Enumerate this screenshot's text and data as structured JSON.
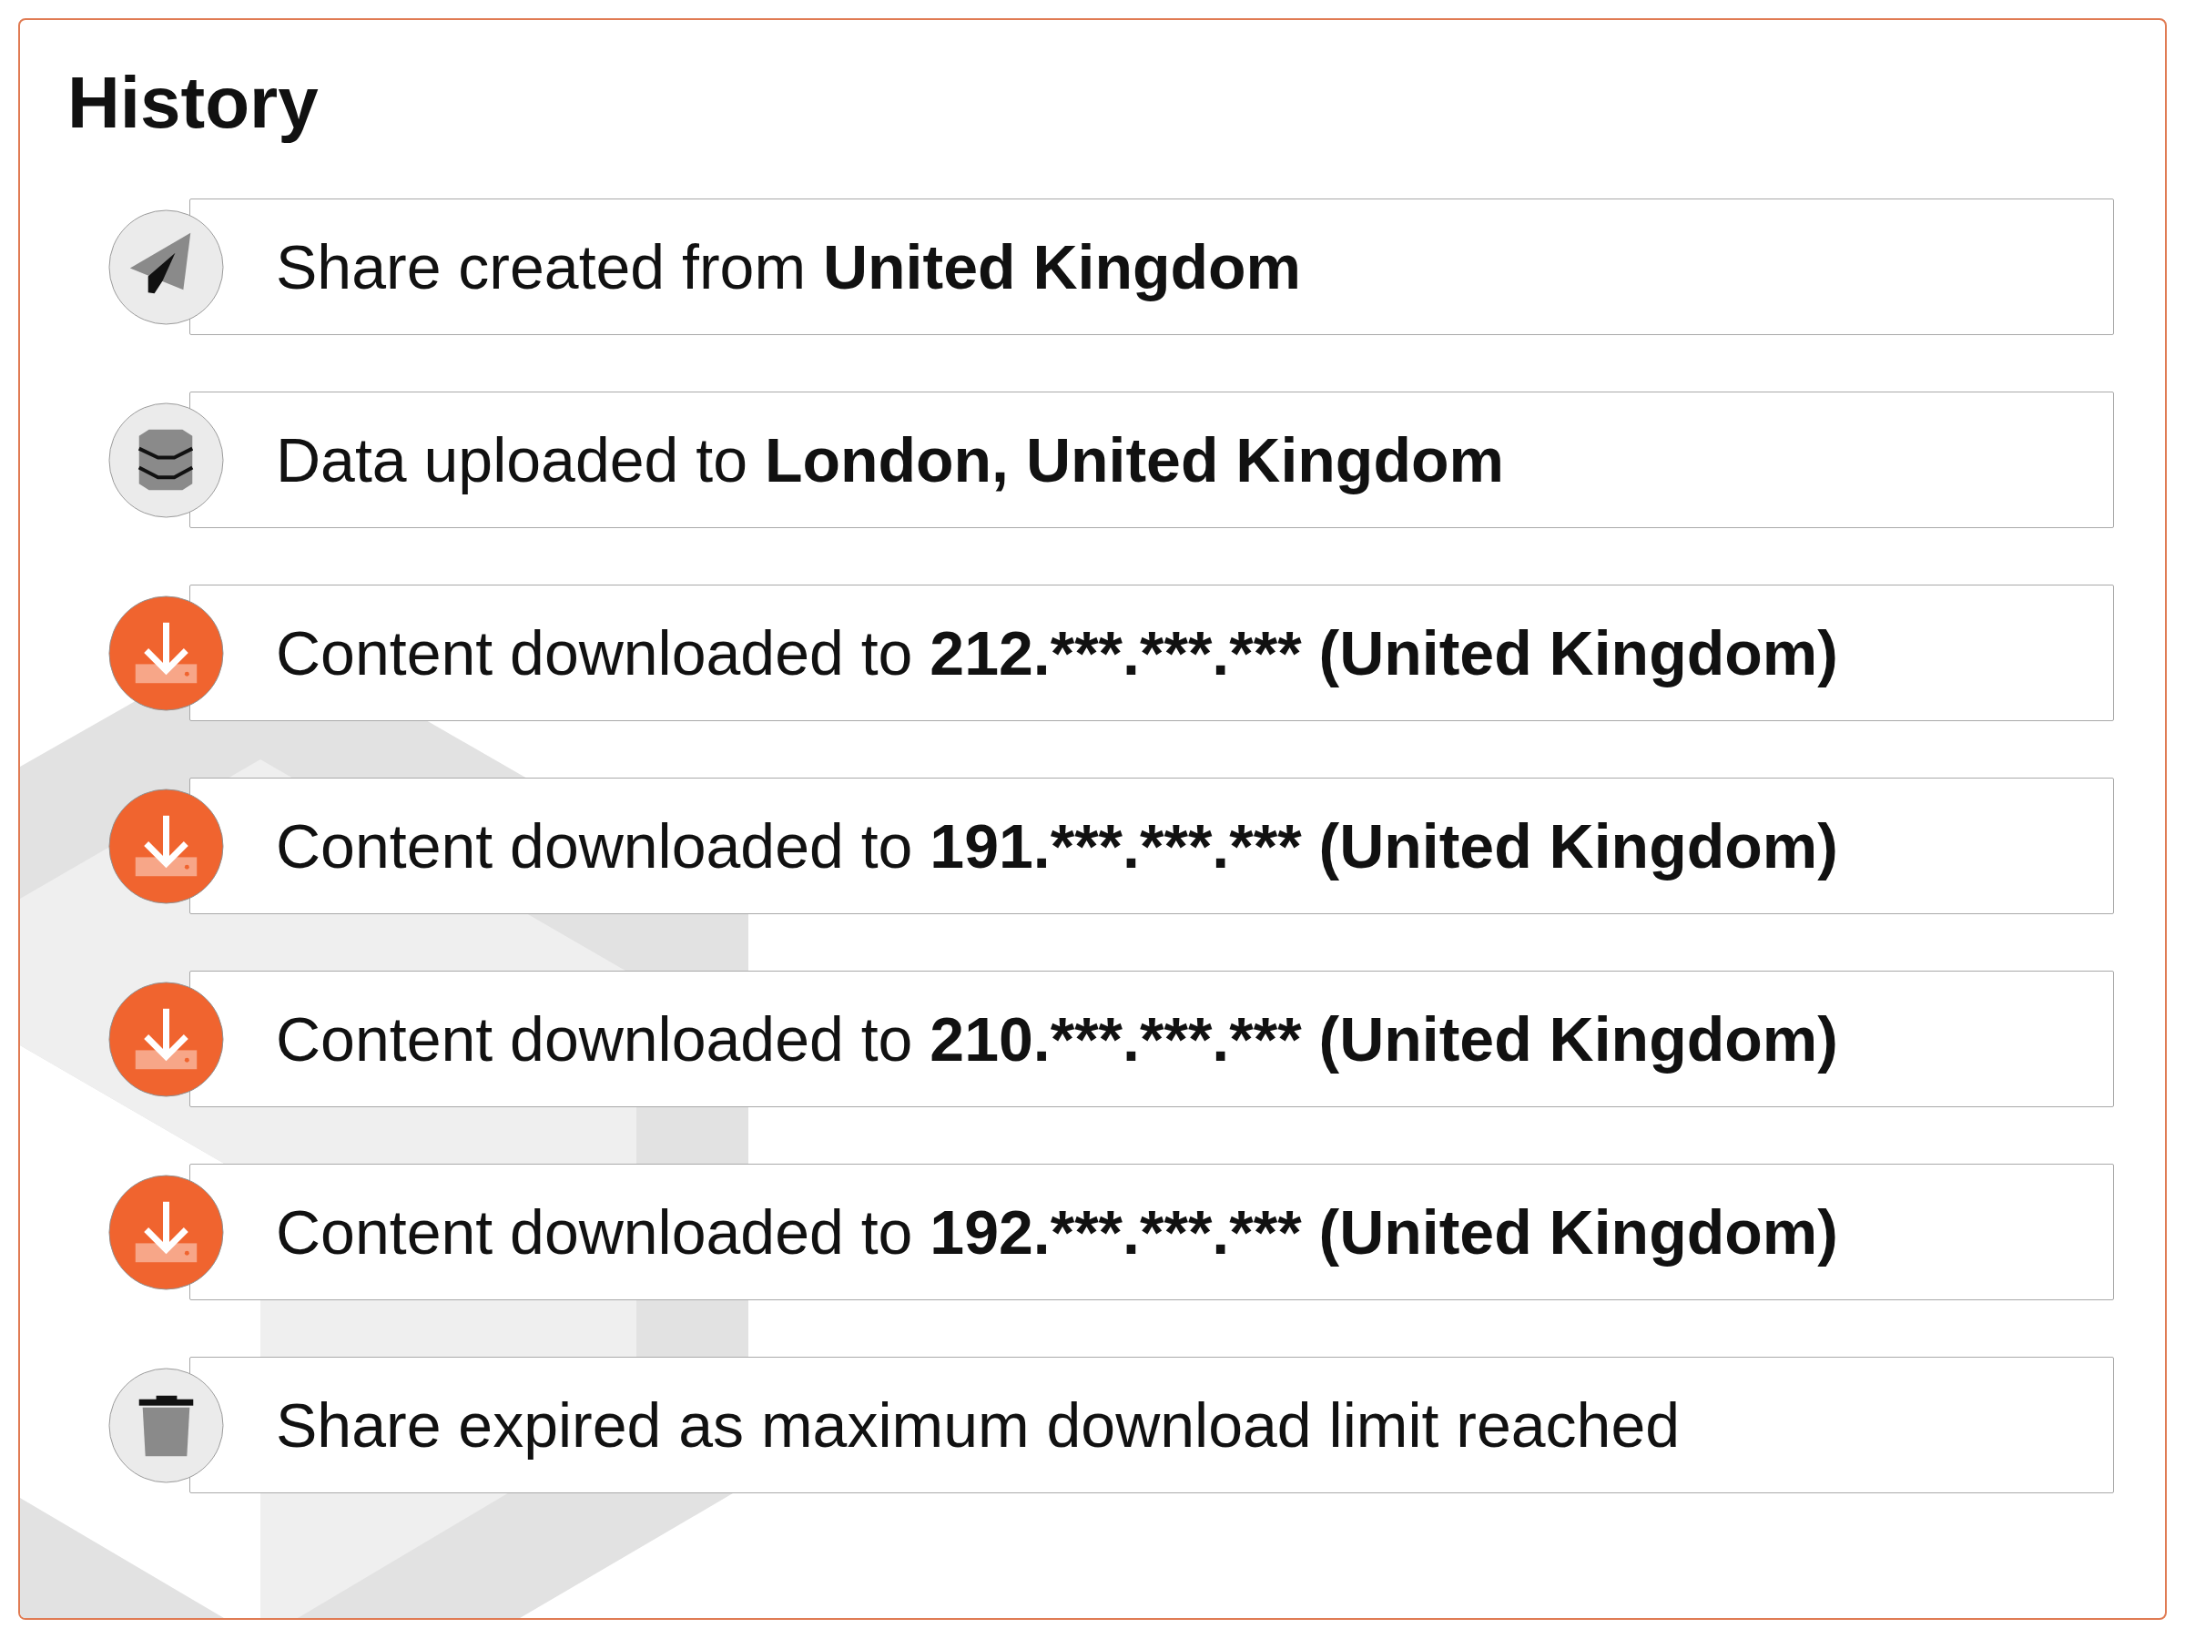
{
  "title": "History",
  "events": [
    {
      "kind": "share_created",
      "text": "Share created from ",
      "bold_text": "United Kingdom"
    },
    {
      "kind": "data_uploaded",
      "text": "Data uploaded to ",
      "bold_text": "London, United Kingdom"
    },
    {
      "kind": "downloaded",
      "text": "Content downloaded to ",
      "bold_text": "212.***.***.*** (United Kingdom)"
    },
    {
      "kind": "downloaded",
      "text": "Content downloaded to ",
      "bold_text": "191.***.***.*** (United Kingdom)"
    },
    {
      "kind": "downloaded",
      "text": "Content downloaded to ",
      "bold_text": "210.***.***.*** (United Kingdom)"
    },
    {
      "kind": "downloaded",
      "text": "Content downloaded to ",
      "bold_text": "192.***.***.*** (United Kingdom)"
    },
    {
      "kind": "expired",
      "text": "Share expired as maximum download limit reached"
    }
  ]
}
